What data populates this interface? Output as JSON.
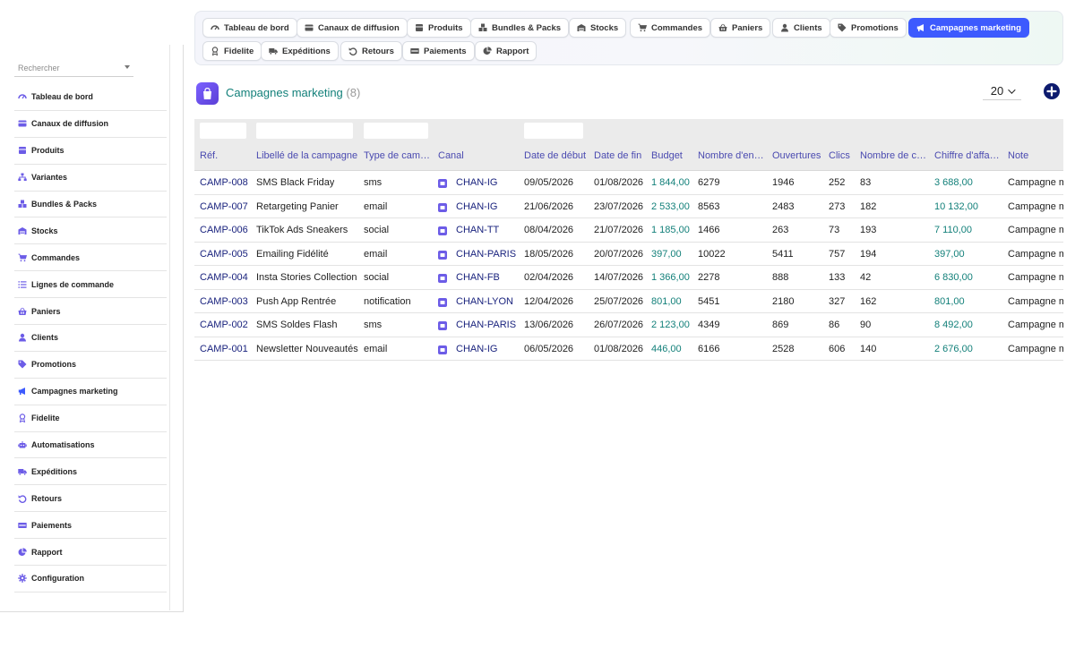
{
  "sidebar": {
    "search_placeholder": "Rechercher",
    "items": [
      {
        "label": "Tableau de bord",
        "icon": "dashboard-icon"
      },
      {
        "label": "Canaux de diffusion",
        "icon": "card-icon"
      },
      {
        "label": "Produits",
        "icon": "box-icon"
      },
      {
        "label": "Variantes",
        "icon": "sitemap-icon"
      },
      {
        "label": "Bundles & Packs",
        "icon": "cubes-icon"
      },
      {
        "label": "Stocks",
        "icon": "warehouse-icon"
      },
      {
        "label": "Commandes",
        "icon": "cart-icon"
      },
      {
        "label": "Lignes de commande",
        "icon": "list-icon"
      },
      {
        "label": "Paniers",
        "icon": "basket-icon"
      },
      {
        "label": "Clients",
        "icon": "user-icon"
      },
      {
        "label": "Promotions",
        "icon": "tags-icon"
      },
      {
        "label": "Campagnes marketing",
        "icon": "megaphone-icon"
      },
      {
        "label": "Fidelite",
        "icon": "award-icon"
      },
      {
        "label": "Automatisations",
        "icon": "robot-icon"
      },
      {
        "label": "Expéditions",
        "icon": "truck-icon"
      },
      {
        "label": "Retours",
        "icon": "undo-icon"
      },
      {
        "label": "Paiements",
        "icon": "money-icon"
      },
      {
        "label": "Rapport",
        "icon": "chart-pie-icon"
      },
      {
        "label": "Configuration",
        "icon": "gear-icon"
      }
    ]
  },
  "tabs": [
    {
      "label": "Tableau de bord",
      "icon": "dashboard-icon"
    },
    {
      "label": "Canaux de diffusion",
      "icon": "card-icon"
    },
    {
      "label": "Produits",
      "icon": "box-icon"
    },
    {
      "label": "Bundles & Packs",
      "icon": "cubes-icon"
    },
    {
      "label": "Stocks",
      "icon": "warehouse-icon"
    },
    {
      "label": "Commandes",
      "icon": "cart-icon"
    },
    {
      "label": "Paniers",
      "icon": "basket-icon"
    },
    {
      "label": "Clients",
      "icon": "user-icon"
    },
    {
      "label": "Promotions",
      "icon": "tags-icon"
    },
    {
      "label": "Campagnes marketing",
      "icon": "megaphone-icon",
      "active": true
    },
    {
      "label": "Fidelite",
      "icon": "award-icon"
    },
    {
      "label": "Expéditions",
      "icon": "truck-icon"
    },
    {
      "label": "Retours",
      "icon": "undo-icon"
    },
    {
      "label": "Paiements",
      "icon": "money-icon"
    },
    {
      "label": "Rapport",
      "icon": "chart-pie-icon"
    }
  ],
  "header": {
    "title": "Campagnes marketing",
    "count": "(8)",
    "per_page": "20"
  },
  "table": {
    "columns": [
      "Réf.",
      "Libellé de la campagne",
      "Type de cam…",
      "Canal",
      "Date de début",
      "Date de fin",
      "Budget",
      "Nombre d'en…",
      "Ouvertures",
      "Clics",
      "Nombre de c…",
      "Chiffre d'affa…",
      "Note"
    ],
    "rows": [
      [
        "CAMP-008",
        "SMS Black Friday",
        "sms",
        "CHAN-IG",
        "09/05/2026",
        "01/08/2026",
        "1 844,00",
        "6279",
        "1946",
        "252",
        "83",
        "3 688,00",
        "Campagne m"
      ],
      [
        "CAMP-007",
        "Retargeting Panier",
        "email",
        "CHAN-IG",
        "21/06/2026",
        "23/07/2026",
        "2 533,00",
        "8563",
        "2483",
        "273",
        "182",
        "10 132,00",
        "Campagne m"
      ],
      [
        "CAMP-006",
        "TikTok Ads Sneakers",
        "social",
        "CHAN-TT",
        "08/04/2026",
        "21/07/2026",
        "1 185,00",
        "1466",
        "263",
        "73",
        "193",
        "7 110,00",
        "Campagne m"
      ],
      [
        "CAMP-005",
        "Emailing Fidélité",
        "email",
        "CHAN-PARIS",
        "18/05/2026",
        "20/07/2026",
        "397,00",
        "10022",
        "5411",
        "757",
        "194",
        "397,00",
        "Campagne m"
      ],
      [
        "CAMP-004",
        "Insta Stories Collection",
        "social",
        "CHAN-FB",
        "02/04/2026",
        "14/07/2026",
        "1 366,00",
        "2278",
        "888",
        "133",
        "42",
        "6 830,00",
        "Campagne m"
      ],
      [
        "CAMP-003",
        "Push App Rentrée",
        "notification",
        "CHAN-LYON",
        "12/04/2026",
        "25/07/2026",
        "801,00",
        "5451",
        "2180",
        "327",
        "162",
        "801,00",
        "Campagne m"
      ],
      [
        "CAMP-002",
        "SMS Soldes Flash",
        "sms",
        "CHAN-PARIS",
        "13/06/2026",
        "26/07/2026",
        "2 123,00",
        "4349",
        "869",
        "86",
        "90",
        "8 492,00",
        "Campagne m"
      ],
      [
        "CAMP-001",
        "Newsletter Nouveautés",
        "email",
        "CHAN-IG",
        "06/05/2026",
        "01/08/2026",
        "446,00",
        "6166",
        "2528",
        "606",
        "140",
        "2 676,00",
        "Campagne m"
      ]
    ]
  },
  "colors": {
    "accent": "#3d5afe",
    "title_teal": "#13807a",
    "link_navy": "#1a237e",
    "header_text": "#4a4ab0",
    "icon_purple": "#6c5ce7"
  }
}
